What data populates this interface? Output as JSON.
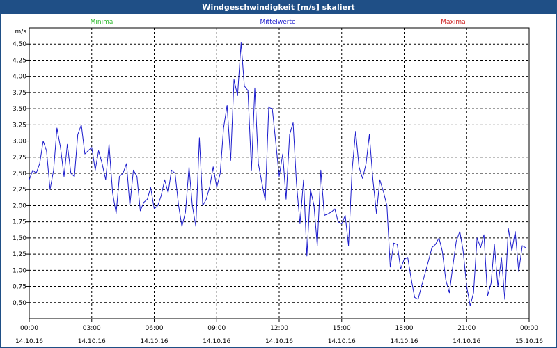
{
  "window": {
    "title": "Windgeschwindigkeit [m/s] skaliert"
  },
  "legend": {
    "minima": {
      "label": "Minima",
      "color": "#2eb82e"
    },
    "mittel": {
      "label": "Mittelwerte",
      "color": "#1a1acc"
    },
    "maxima": {
      "label": "Maxima",
      "color": "#cc2222"
    }
  },
  "chart_data": {
    "type": "line",
    "title": "Windgeschwindigkeit [m/s] skaliert",
    "ylabel": "m/s",
    "xlabel": "",
    "ylim": [
      0.25,
      4.75
    ],
    "yticks": [
      "4,50",
      "4,25",
      "4,00",
      "3,75",
      "3,50",
      "3,25",
      "3,00",
      "2,75",
      "2,50",
      "2,25",
      "2,00",
      "1,75",
      "1,50",
      "1,25",
      "1,00",
      "0,75",
      "0,50"
    ],
    "xticks": [
      {
        "time": "00:00",
        "date": "14.10.16"
      },
      {
        "time": "03:00",
        "date": "14.10.16"
      },
      {
        "time": "06:00",
        "date": "14.10.16"
      },
      {
        "time": "09:00",
        "date": "14.10.16"
      },
      {
        "time": "12:00",
        "date": "14.10.16"
      },
      {
        "time": "15:00",
        "date": "14.10.16"
      },
      {
        "time": "18:00",
        "date": "14.10.16"
      },
      {
        "time": "21:00",
        "date": "14.10.16"
      },
      {
        "time": "00:00",
        "date": "15.10.16"
      }
    ],
    "xlim_hours": [
      0,
      24
    ],
    "grid": true,
    "series": [
      {
        "name": "Mittelwerte",
        "color": "#1a1acc",
        "x_hours": [
          0.0,
          0.17,
          0.33,
          0.5,
          0.67,
          0.83,
          1.0,
          1.17,
          1.33,
          1.5,
          1.67,
          1.83,
          2.0,
          2.17,
          2.33,
          2.5,
          2.67,
          2.83,
          3.0,
          3.17,
          3.33,
          3.5,
          3.67,
          3.83,
          4.0,
          4.17,
          4.33,
          4.5,
          4.67,
          4.83,
          5.0,
          5.17,
          5.33,
          5.5,
          5.67,
          5.83,
          6.0,
          6.17,
          6.33,
          6.5,
          6.67,
          6.83,
          7.0,
          7.17,
          7.33,
          7.5,
          7.67,
          7.83,
          8.0,
          8.17,
          8.33,
          8.5,
          8.67,
          8.83,
          9.0,
          9.17,
          9.33,
          9.5,
          9.67,
          9.83,
          10.0,
          10.17,
          10.33,
          10.5,
          10.67,
          10.83,
          11.0,
          11.17,
          11.33,
          11.5,
          11.67,
          11.83,
          12.0,
          12.17,
          12.33,
          12.5,
          12.67,
          12.83,
          13.0,
          13.17,
          13.33,
          13.5,
          13.67,
          13.83,
          14.0,
          14.17,
          14.33,
          14.5,
          14.67,
          14.83,
          15.0,
          15.17,
          15.33,
          15.5,
          15.67,
          15.83,
          16.0,
          16.17,
          16.33,
          16.5,
          16.67,
          16.83,
          17.0,
          17.17,
          17.33,
          17.5,
          17.67,
          17.83,
          18.0,
          18.17,
          18.33,
          18.5,
          18.67,
          18.83,
          19.0,
          19.17,
          19.33,
          19.5,
          19.67,
          19.83,
          20.0,
          20.17,
          20.33,
          20.5,
          20.67,
          20.83,
          21.0,
          21.17,
          21.33,
          21.5,
          21.67,
          21.83,
          22.0,
          22.17,
          22.33,
          22.5,
          22.67,
          22.83,
          23.0,
          23.17,
          23.33,
          23.5,
          23.67,
          23.83,
          24.0
        ],
        "values": [
          2.4,
          2.55,
          2.5,
          2.65,
          3.0,
          2.85,
          2.25,
          2.55,
          3.2,
          2.9,
          2.45,
          2.95,
          2.5,
          2.45,
          3.1,
          3.25,
          2.8,
          2.85,
          2.9,
          2.55,
          2.85,
          2.65,
          2.4,
          2.95,
          2.2,
          1.88,
          2.45,
          2.5,
          2.65,
          2.0,
          2.55,
          2.45,
          1.92,
          2.05,
          2.1,
          2.28,
          1.95,
          2.0,
          2.15,
          2.4,
          2.2,
          2.55,
          2.5,
          2.0,
          1.68,
          1.9,
          2.6,
          2.0,
          1.68,
          3.05,
          2.0,
          2.1,
          2.3,
          2.6,
          2.28,
          2.5,
          3.2,
          3.55,
          2.7,
          3.95,
          3.7,
          4.52,
          3.85,
          3.78,
          2.55,
          3.82,
          2.65,
          2.35,
          2.08,
          3.52,
          3.5,
          3.0,
          2.45,
          2.8,
          2.1,
          3.1,
          3.28,
          2.35,
          1.72,
          2.4,
          1.22,
          2.25,
          2.0,
          1.38,
          2.55,
          1.85,
          1.87,
          1.9,
          1.95,
          1.75,
          1.72,
          1.85,
          1.38,
          2.55,
          3.15,
          2.6,
          2.42,
          2.65,
          3.1,
          2.4,
          1.88,
          2.4,
          2.22,
          2.0,
          1.05,
          1.42,
          1.4,
          1.02,
          1.17,
          1.2,
          0.88,
          0.58,
          0.55,
          0.75,
          0.95,
          1.15,
          1.35,
          1.4,
          1.5,
          1.3,
          0.85,
          0.65,
          1.05,
          1.45,
          1.6,
          1.3,
          0.75,
          0.45,
          0.65,
          1.5,
          1.35,
          1.55,
          0.6,
          0.8,
          1.4,
          0.75,
          1.2,
          0.55,
          1.65,
          1.3,
          1.6,
          0.98,
          1.38,
          1.35
        ]
      }
    ]
  }
}
